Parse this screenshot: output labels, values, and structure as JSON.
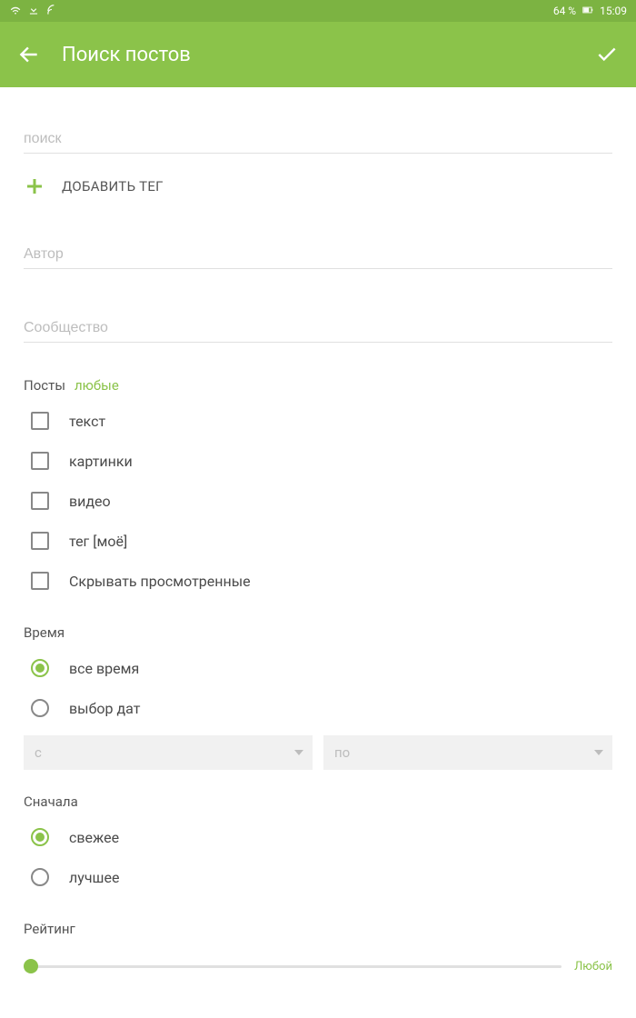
{
  "status": {
    "battery": "64 %",
    "time": "15:09"
  },
  "toolbar": {
    "title": "Поиск постов"
  },
  "fields": {
    "search_placeholder": "поиск",
    "author_placeholder": "Автор",
    "community_placeholder": "Сообщество"
  },
  "add_tag_label": "ДОБАВИТЬ ТЕГ",
  "posts": {
    "label": "Посты",
    "hint": "любые",
    "options": [
      "текст",
      "картинки",
      "видео",
      "тег [моё]",
      "Скрывать просмотренные"
    ]
  },
  "time": {
    "label": "Время",
    "options": [
      "все время",
      "выбор дат"
    ],
    "selected": 0,
    "from_placeholder": "с",
    "to_placeholder": "по"
  },
  "sort": {
    "label": "Сначала",
    "options": [
      "свежее",
      "лучшее"
    ],
    "selected": 0
  },
  "rating": {
    "label": "Рейтинг",
    "value_label": "Любой"
  }
}
